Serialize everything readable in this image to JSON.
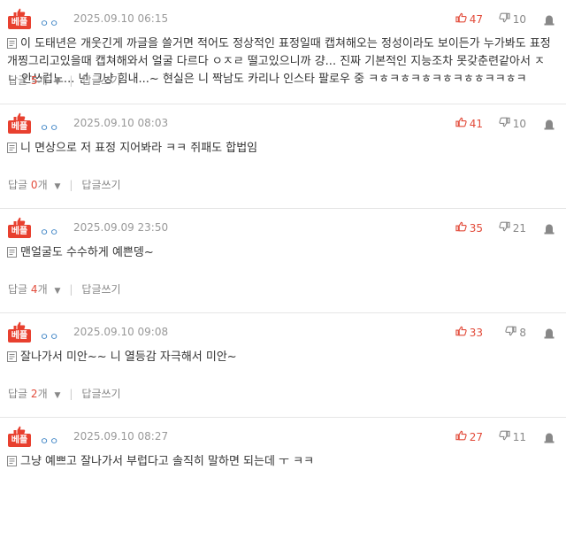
{
  "labels": {
    "best": "베플",
    "reply": "답글",
    "reply_unit": "개",
    "write_reply": "답글쓰기"
  },
  "colors": {
    "accent": "#e8402f",
    "like": "#e24b3a",
    "nick": "#3b82c4"
  },
  "comments": [
    {
      "nick": "ㅇㅇ",
      "date": "2025.09.10 06:15",
      "likes": "47",
      "dislikes": "10",
      "text": "이 도태년은 개웃긴게 까글을 쓸거면 적어도 정상적인 표정일때 캡쳐해오는 정성이라도 보이든가 누가봐도 표정 개찡그리고있을때 캡쳐해와서 얼굴 다르다 ㅇㅈㄹ 떨고있으니까 걍... 진짜 기본적인 지능조차 못갖춘련같아서 ㅈㄴ 안쓰럽노... 넌 그냥 힘내...~ 현실은 니 짝남도 카리나 인스타 팔로우 중 ㅋㅎㅋㅎㅋㅎㅋㅎㅋㅎㅎㅋㅋㅎㅋ",
      "reply_count": "5"
    },
    {
      "nick": "ㅇㅇ",
      "date": "2025.09.10 08:03",
      "likes": "41",
      "dislikes": "10",
      "text": "니 면상으로 저 표정 지어봐라 ㅋㅋ 쥐패도 합법임",
      "reply_count": "0"
    },
    {
      "nick": "ㅇㅇ",
      "date": "2025.09.09 23:50",
      "likes": "35",
      "dislikes": "21",
      "text": "맨얼굴도 수수하게 예쁜뎅~",
      "reply_count": "4"
    },
    {
      "nick": "ㅇㅇ",
      "date": "2025.09.10 09:08",
      "likes": "33",
      "dislikes": "8",
      "text": "잘나가서 미안~~ 니 열등감 자극해서 미안~",
      "reply_count": "2"
    },
    {
      "nick": "ㅇㅇ",
      "date": "2025.09.10 08:27",
      "likes": "27",
      "dislikes": "11",
      "text": "그냥 예쁘고 잘나가서 부럽다고 솔직히 말하면 되는데 ㅜ ㅋㅋ",
      "reply_count": null
    }
  ]
}
